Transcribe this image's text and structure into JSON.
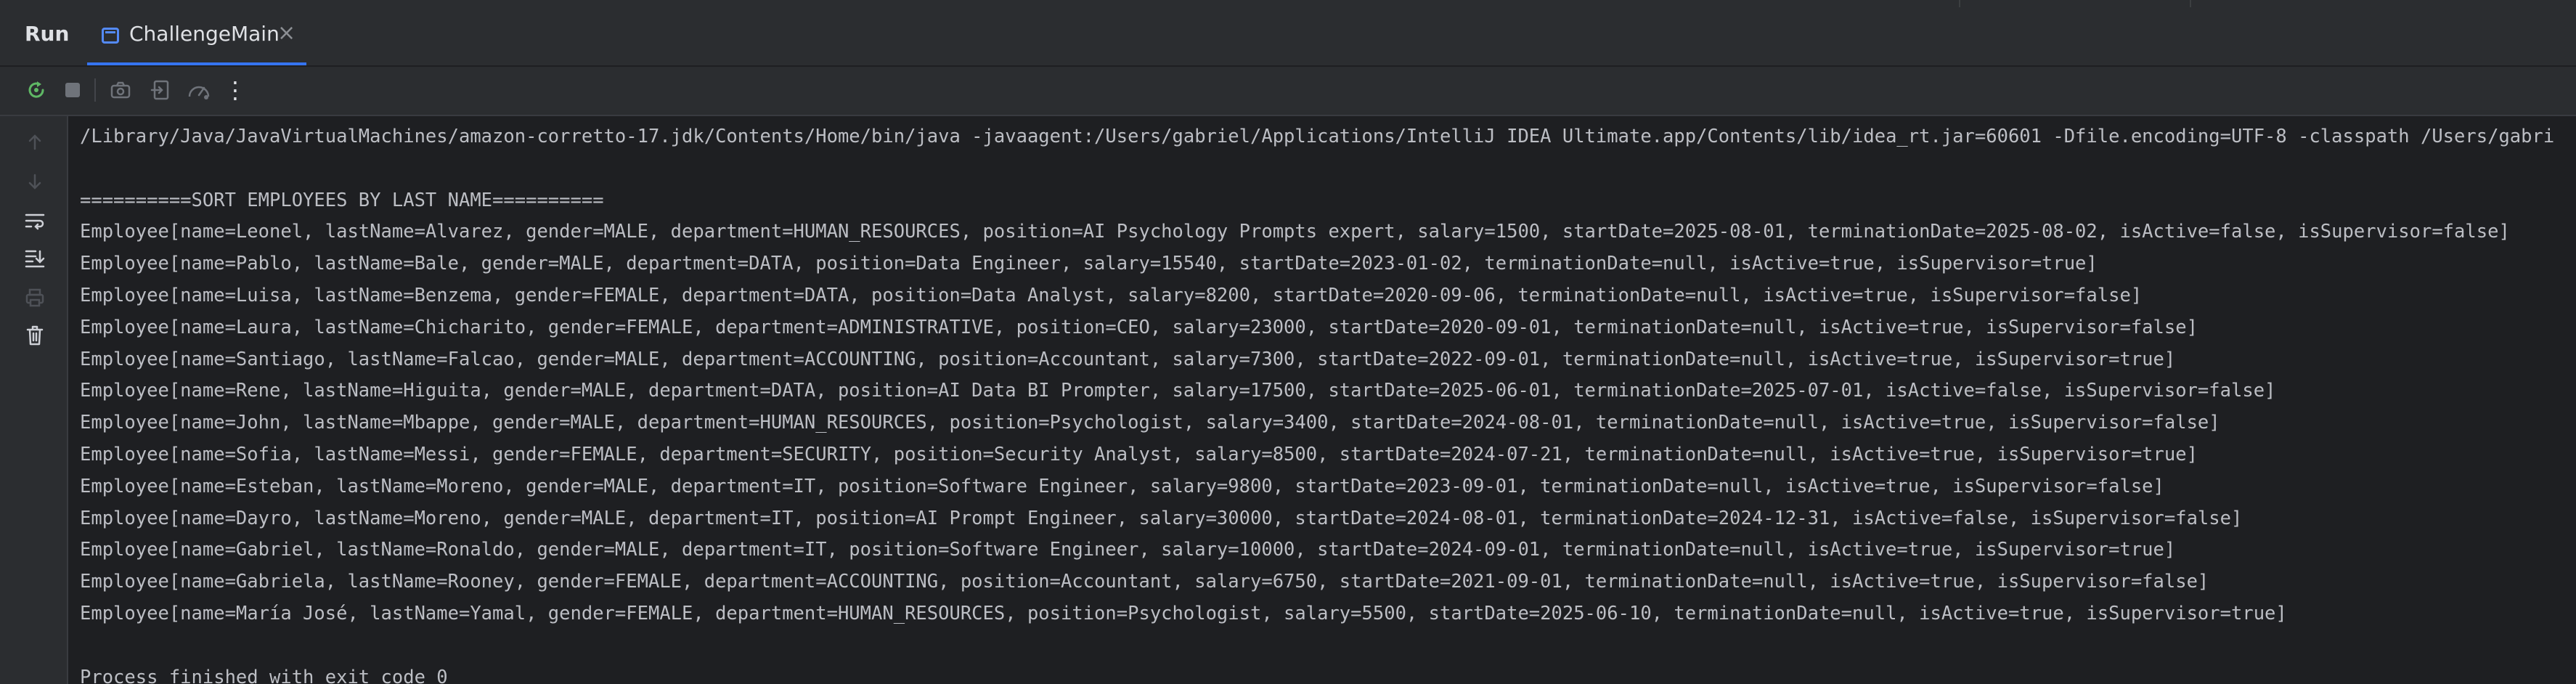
{
  "header": {
    "run_label": "Run",
    "tab": {
      "label": "ChallengeMain",
      "icon": "java-class-file-icon",
      "close_glyph": "×"
    }
  },
  "toolbar": {
    "buttons": [
      {
        "name": "rerun-button",
        "icon": "rerun-icon"
      },
      {
        "name": "stop-button",
        "icon": "stop-square-icon"
      },
      {
        "name": "screenshot-button",
        "icon": "camera-icon"
      },
      {
        "name": "restore-layout-button",
        "icon": "exit-to-panel-icon"
      },
      {
        "name": "profiler-button",
        "icon": "gauge-icon"
      },
      {
        "name": "more-options-button",
        "icon": "more-vertical-icon",
        "glyph": "⋮"
      }
    ]
  },
  "gutter": {
    "buttons": [
      {
        "name": "scroll-up-button",
        "icon": "arrow-up-icon"
      },
      {
        "name": "scroll-down-button",
        "icon": "arrow-down-icon"
      },
      {
        "name": "soft-wrap-button",
        "icon": "soft-wrap-icon"
      },
      {
        "name": "scroll-to-end-button",
        "icon": "scroll-to-end-icon"
      },
      {
        "name": "print-button",
        "icon": "printer-icon"
      },
      {
        "name": "clear-all-button",
        "icon": "trash-icon"
      }
    ]
  },
  "colors": {
    "background": "#1e1f22",
    "panel": "#2b2d30",
    "console_text": "#bcbec4",
    "accent": "#3574f0",
    "rerun_green": "#5fb865"
  },
  "console": {
    "lines": [
      "/Library/Java/JavaVirtualMachines/amazon-corretto-17.jdk/Contents/Home/bin/java -javaagent:/Users/gabriel/Applications/IntelliJ IDEA Ultimate.app/Contents/lib/idea_rt.jar=60601 -Dfile.encoding=UTF-8 -classpath /Users/gabri",
      "",
      "==========SORT EMPLOYEES BY LAST NAME==========",
      "Employee[name=Leonel, lastName=Alvarez, gender=MALE, department=HUMAN_RESOURCES, position=AI Psychology Prompts expert, salary=1500, startDate=2025-08-01, terminationDate=2025-08-02, isActive=false, isSupervisor=false]",
      "Employee[name=Pablo, lastName=Bale, gender=MALE, department=DATA, position=Data Engineer, salary=15540, startDate=2023-01-02, terminationDate=null, isActive=true, isSupervisor=true]",
      "Employee[name=Luisa, lastName=Benzema, gender=FEMALE, department=DATA, position=Data Analyst, salary=8200, startDate=2020-09-06, terminationDate=null, isActive=true, isSupervisor=false]",
      "Employee[name=Laura, lastName=Chicharito, gender=FEMALE, department=ADMINISTRATIVE, position=CEO, salary=23000, startDate=2020-09-01, terminationDate=null, isActive=true, isSupervisor=false]",
      "Employee[name=Santiago, lastName=Falcao, gender=MALE, department=ACCOUNTING, position=Accountant, salary=7300, startDate=2022-09-01, terminationDate=null, isActive=true, isSupervisor=true]",
      "Employee[name=Rene, lastName=Higuita, gender=MALE, department=DATA, position=AI Data BI Prompter, salary=17500, startDate=2025-06-01, terminationDate=2025-07-01, isActive=false, isSupervisor=false]",
      "Employee[name=John, lastName=Mbappe, gender=MALE, department=HUMAN_RESOURCES, position=Psychologist, salary=3400, startDate=2024-08-01, terminationDate=null, isActive=true, isSupervisor=false]",
      "Employee[name=Sofia, lastName=Messi, gender=FEMALE, department=SECURITY, position=Security Analyst, salary=8500, startDate=2024-07-21, terminationDate=null, isActive=true, isSupervisor=true]",
      "Employee[name=Esteban, lastName=Moreno, gender=MALE, department=IT, position=Software Engineer, salary=9800, startDate=2023-09-01, terminationDate=null, isActive=true, isSupervisor=false]",
      "Employee[name=Dayro, lastName=Moreno, gender=MALE, department=IT, position=AI Prompt Engineer, salary=30000, startDate=2024-08-01, terminationDate=2024-12-31, isActive=false, isSupervisor=false]",
      "Employee[name=Gabriel, lastName=Ronaldo, gender=MALE, department=IT, position=Software Engineer, salary=10000, startDate=2024-09-01, terminationDate=null, isActive=true, isSupervisor=true]",
      "Employee[name=Gabriela, lastName=Rooney, gender=FEMALE, department=ACCOUNTING, position=Accountant, salary=6750, startDate=2021-09-01, terminationDate=null, isActive=true, isSupervisor=false]",
      "Employee[name=María José, lastName=Yamal, gender=FEMALE, department=HUMAN_RESOURCES, position=Psychologist, salary=5500, startDate=2025-06-10, terminationDate=null, isActive=true, isSupervisor=true]",
      "",
      "Process finished with exit code 0"
    ]
  }
}
